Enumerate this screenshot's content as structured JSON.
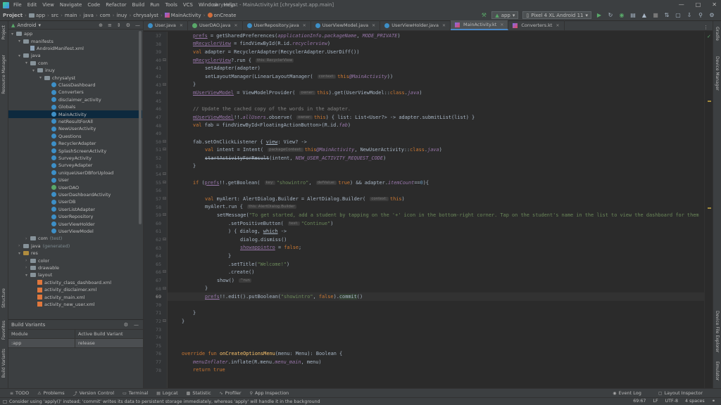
{
  "window": {
    "title": "chrysalyst - MainActivity.kt [chrysalyst.app.main]",
    "menu": [
      "File",
      "Edit",
      "View",
      "Navigate",
      "Code",
      "Refactor",
      "Build",
      "Run",
      "Tools",
      "VCS",
      "Window",
      "Help"
    ]
  },
  "breadcrumb": [
    "Project",
    "app",
    "src",
    "main",
    "java",
    "com",
    "inuy",
    "chrysalyst",
    "MainActivity",
    "onCreate"
  ],
  "toolbar": {
    "config": "app",
    "device": "Pixel 4 XL Android 11"
  },
  "project_panel": {
    "view_selector": "Android",
    "tree": [
      {
        "label": "app",
        "icon": "folder",
        "depth": 0,
        "expanded": true
      },
      {
        "label": "manifests",
        "icon": "folder",
        "depth": 1,
        "expanded": true
      },
      {
        "label": "AndroidManifest.xml",
        "icon": "manifest",
        "depth": 2
      },
      {
        "label": "java",
        "icon": "folder",
        "depth": 1,
        "expanded": true
      },
      {
        "label": "com",
        "icon": "folder",
        "depth": 2,
        "expanded": true
      },
      {
        "label": "inuy",
        "icon": "folder",
        "depth": 3,
        "expanded": true
      },
      {
        "label": "chrysalyst",
        "icon": "folder",
        "depth": 4,
        "expanded": true
      },
      {
        "label": "ClassDashboard",
        "icon": "class",
        "depth": 5
      },
      {
        "label": "Converters",
        "icon": "class",
        "depth": 5
      },
      {
        "label": "disclaimer_activity",
        "icon": "class",
        "depth": 5
      },
      {
        "label": "Globals",
        "icon": "class",
        "depth": 5
      },
      {
        "label": "MainActivity",
        "icon": "class",
        "depth": 5
      },
      {
        "label": "netResultForAll",
        "icon": "class",
        "depth": 5
      },
      {
        "label": "NewUserActivity",
        "icon": "class",
        "depth": 5
      },
      {
        "label": "Questions",
        "icon": "class",
        "depth": 5
      },
      {
        "label": "RecyclerAdapter",
        "icon": "class",
        "depth": 5
      },
      {
        "label": "SplashScreenActivity",
        "icon": "class",
        "depth": 5
      },
      {
        "label": "SurveyActivity",
        "icon": "class",
        "depth": 5
      },
      {
        "label": "SurveyAdapter",
        "icon": "class",
        "depth": 5
      },
      {
        "label": "uniqueUserDBforUpload",
        "icon": "class",
        "depth": 5
      },
      {
        "label": "User",
        "icon": "class",
        "depth": 5
      },
      {
        "label": "UserDAO",
        "icon": "interface",
        "depth": 5
      },
      {
        "label": "UserDashboardActivity",
        "icon": "class",
        "depth": 5
      },
      {
        "label": "UserDB",
        "icon": "class",
        "depth": 5
      },
      {
        "label": "UserListAdapter",
        "icon": "class",
        "depth": 5
      },
      {
        "label": "UserRepository",
        "icon": "class",
        "depth": 5
      },
      {
        "label": "UserViewHolder",
        "icon": "class",
        "depth": 5
      },
      {
        "label": "UserViewModel",
        "icon": "class",
        "depth": 5
      },
      {
        "label": "com",
        "icon": "folder",
        "depth": 2,
        "suffix": "(test)"
      },
      {
        "label": "java",
        "icon": "folder",
        "depth": 1,
        "suffix": "(generated)"
      },
      {
        "label": "res",
        "icon": "res",
        "depth": 1,
        "expanded": true
      },
      {
        "label": "color",
        "icon": "folder",
        "depth": 2
      },
      {
        "label": "drawable",
        "icon": "folder",
        "depth": 2
      },
      {
        "label": "layout",
        "icon": "folder",
        "depth": 2,
        "expanded": true
      },
      {
        "label": "activity_class_dashboard.xml",
        "icon": "xml",
        "depth": 3
      },
      {
        "label": "activity_disclaimer.xml",
        "icon": "xml",
        "depth": 3
      },
      {
        "label": "activity_main.xml",
        "icon": "xml",
        "depth": 3
      },
      {
        "label": "activity_new_user.xml",
        "icon": "xml",
        "depth": 3
      }
    ]
  },
  "build_variants": {
    "title": "Build Variants",
    "col_module": "Module",
    "col_variant": "Active Build Variant",
    "module": ":app",
    "variant": "release"
  },
  "tabs": [
    {
      "label": "User.java",
      "icon": "java"
    },
    {
      "label": "UserDAO.java",
      "icon": "interface"
    },
    {
      "label": "UserRepository.java",
      "icon": "java"
    },
    {
      "label": "UserViewModel.java",
      "icon": "java"
    },
    {
      "label": "UserViewHolder.java",
      "icon": "java"
    },
    {
      "label": "MainActivity.kt",
      "icon": "kotlin",
      "active": true
    },
    {
      "label": "Converters.kt",
      "icon": "kotlin"
    }
  ],
  "line_numbers": [
    "37",
    "38",
    "39",
    "40",
    "41",
    "42",
    "43",
    "44",
    "45",
    "46",
    "47",
    "48",
    "49",
    "50",
    "51",
    "52",
    "53",
    "54",
    "55",
    "56",
    "57",
    "58",
    "59",
    "60",
    "61",
    "62",
    "63",
    "64",
    "65",
    "66",
    "67",
    "68",
    "69",
    "70",
    "71",
    "72",
    "73",
    "74",
    "75",
    "76",
    "77",
    "78"
  ],
  "current_line": "69",
  "hints": {
    "this_recyclerview": "this: RecyclerView",
    "context": "context:",
    "owner1": "owner:",
    "owner2": "owner:",
    "package_context": "packageContext:",
    "key": "key:",
    "def_value": "defValue:",
    "context2": "context:",
    "this_alertdialog": "this: AlertDialog.Builder",
    "text": "text:",
    "unit": "^run"
  },
  "code_comment": "// Update the cached copy of the words in the adapter.",
  "code_strings": {
    "showintro": "\"showintro\"",
    "message": "\"To get started, add a student by tapping on the '+' icon in the bottom-right corner. Tap on the student's name in the list to view the dashboard for them",
    "continue": "\"Continue\"",
    "welcome": "\"Welcome!\"",
    "showintro2": "\"showintro\""
  },
  "bottom_tools": [
    "TODO",
    "Problems",
    "Version Control",
    "Terminal",
    "Logcat",
    "Statistic",
    "Profiler",
    "App Inspection"
  ],
  "bottom_right_tools": [
    "Event Log",
    "Layout Inspector"
  ],
  "status": {
    "message": "Consider using 'apply()' instead; 'commit' writes its data to persistent storage immediately, whereas 'apply' will handle it in the background",
    "position": "69:67",
    "line_sep": "LF",
    "encoding": "UTF-8",
    "indent": "4 spaces"
  },
  "side_tools_left": [
    "Project",
    "Resource Manager",
    "Structure",
    "Favorites",
    "Build Variants"
  ],
  "side_tools_right": [
    "Gradle",
    "Device Manager",
    "Device File Explorer",
    "Emulator"
  ]
}
